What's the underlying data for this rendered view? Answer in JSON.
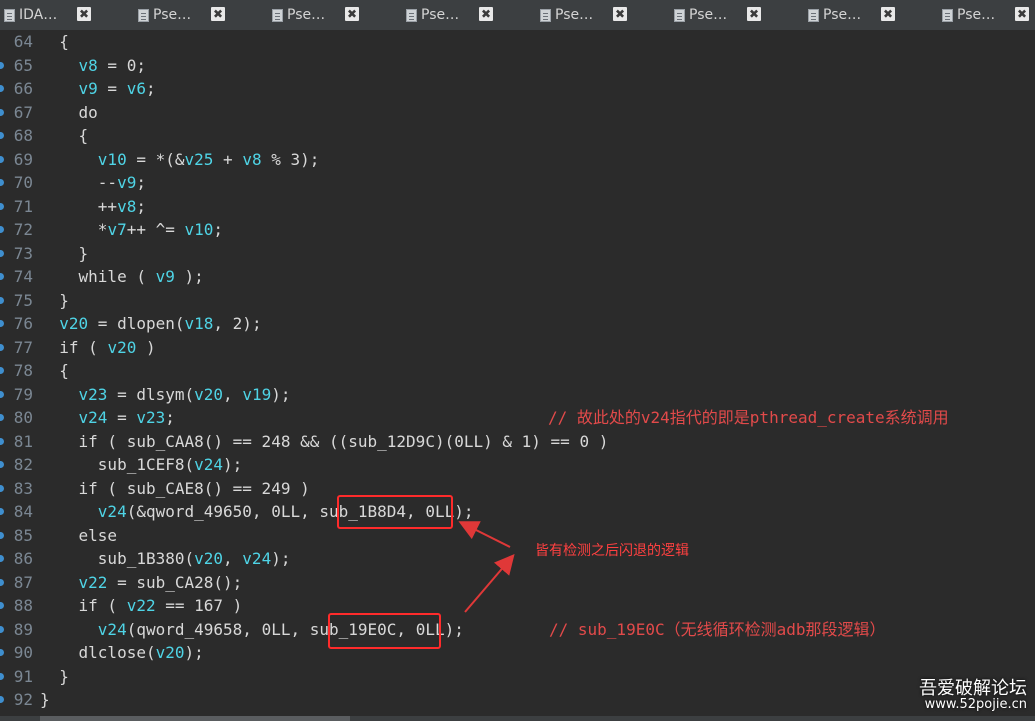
{
  "tabs": [
    {
      "label": "IDA…",
      "icon": "document-icon"
    },
    {
      "label": "Pse…",
      "icon": "document-icon"
    },
    {
      "label": "Pse…",
      "icon": "document-icon"
    },
    {
      "label": "Pse…",
      "icon": "document-icon"
    },
    {
      "label": "Pse…",
      "icon": "document-icon"
    },
    {
      "label": "Pse…",
      "icon": "document-icon"
    },
    {
      "label": "Pse…",
      "icon": "document-icon"
    },
    {
      "label": "Pse…",
      "icon": "document-icon"
    }
  ],
  "close_glyph": "✖",
  "lines": [
    {
      "n": "64",
      "dot": false,
      "indent": "  ",
      "segs": [
        [
          "{",
          ""
        ]
      ]
    },
    {
      "n": "65",
      "dot": true,
      "indent": "    ",
      "segs": [
        [
          "v8",
          "v"
        ],
        [
          " = 0;",
          ""
        ]
      ]
    },
    {
      "n": "66",
      "dot": true,
      "indent": "    ",
      "segs": [
        [
          "v9",
          "v"
        ],
        [
          " = ",
          ""
        ],
        [
          "v6",
          "v"
        ],
        [
          ";",
          ""
        ]
      ]
    },
    {
      "n": "67",
      "dot": true,
      "indent": "    ",
      "segs": [
        [
          "do",
          ""
        ]
      ]
    },
    {
      "n": "68",
      "dot": true,
      "indent": "    ",
      "segs": [
        [
          "{",
          ""
        ]
      ]
    },
    {
      "n": "69",
      "dot": true,
      "indent": "      ",
      "segs": [
        [
          "v10",
          "v"
        ],
        [
          " = *(&",
          ""
        ],
        [
          "v25",
          "v"
        ],
        [
          " + ",
          ""
        ],
        [
          "v8",
          "v"
        ],
        [
          " % 3);",
          ""
        ]
      ]
    },
    {
      "n": "70",
      "dot": true,
      "indent": "      ",
      "segs": [
        [
          "--",
          ""
        ],
        [
          "v9",
          "v"
        ],
        [
          ";",
          ""
        ]
      ]
    },
    {
      "n": "71",
      "dot": true,
      "indent": "      ",
      "segs": [
        [
          "++",
          ""
        ],
        [
          "v8",
          "v"
        ],
        [
          ";",
          ""
        ]
      ]
    },
    {
      "n": "72",
      "dot": true,
      "indent": "      ",
      "segs": [
        [
          "*",
          ""
        ],
        [
          "v7",
          "v"
        ],
        [
          "++ ^= ",
          ""
        ],
        [
          "v10",
          "v"
        ],
        [
          ";",
          ""
        ]
      ]
    },
    {
      "n": "73",
      "dot": true,
      "indent": "    ",
      "segs": [
        [
          "}",
          ""
        ]
      ]
    },
    {
      "n": "74",
      "dot": true,
      "indent": "    ",
      "segs": [
        [
          "while ( ",
          ""
        ],
        [
          "v9",
          "v"
        ],
        [
          " );",
          ""
        ]
      ]
    },
    {
      "n": "75",
      "dot": true,
      "indent": "  ",
      "segs": [
        [
          "}",
          ""
        ]
      ]
    },
    {
      "n": "76",
      "dot": true,
      "indent": "  ",
      "segs": [
        [
          "v20",
          "v"
        ],
        [
          " = dlopen(",
          ""
        ],
        [
          "v18",
          "v"
        ],
        [
          ", 2);",
          ""
        ]
      ]
    },
    {
      "n": "77",
      "dot": true,
      "indent": "  ",
      "segs": [
        [
          "if ( ",
          ""
        ],
        [
          "v20",
          "v"
        ],
        [
          " )",
          ""
        ]
      ]
    },
    {
      "n": "78",
      "dot": true,
      "indent": "  ",
      "segs": [
        [
          "{",
          ""
        ]
      ]
    },
    {
      "n": "79",
      "dot": true,
      "indent": "    ",
      "segs": [
        [
          "v23",
          "v"
        ],
        [
          " = dlsym(",
          ""
        ],
        [
          "v20",
          "v"
        ],
        [
          ", ",
          ""
        ],
        [
          "v19",
          "v"
        ],
        [
          ");",
          ""
        ]
      ]
    },
    {
      "n": "80",
      "dot": true,
      "indent": "    ",
      "segs": [
        [
          "v24",
          "v"
        ],
        [
          " = ",
          ""
        ],
        [
          "v23",
          "v"
        ],
        [
          ";",
          ""
        ]
      ]
    },
    {
      "n": "81",
      "dot": true,
      "indent": "    ",
      "segs": [
        [
          "if ( sub_CAA8() == 248 && ((sub_12D9C)(0LL) & 1) == 0 )",
          ""
        ]
      ]
    },
    {
      "n": "82",
      "dot": true,
      "indent": "      ",
      "segs": [
        [
          "sub_1CEF8(",
          ""
        ],
        [
          "v24",
          "v"
        ],
        [
          ");",
          ""
        ]
      ]
    },
    {
      "n": "83",
      "dot": true,
      "indent": "    ",
      "segs": [
        [
          "if ( sub_CAE8() == 249 )",
          ""
        ]
      ]
    },
    {
      "n": "84",
      "dot": true,
      "indent": "      ",
      "segs": [
        [
          "v24",
          "v"
        ],
        [
          "(&qword_49650, 0LL, sub_1B8D4, 0LL);",
          ""
        ]
      ]
    },
    {
      "n": "85",
      "dot": true,
      "indent": "    ",
      "segs": [
        [
          "else",
          ""
        ]
      ]
    },
    {
      "n": "86",
      "dot": true,
      "indent": "      ",
      "segs": [
        [
          "sub_1B380(",
          ""
        ],
        [
          "v20",
          "v"
        ],
        [
          ", ",
          ""
        ],
        [
          "v24",
          "v"
        ],
        [
          ");",
          ""
        ]
      ]
    },
    {
      "n": "87",
      "dot": true,
      "indent": "    ",
      "segs": [
        [
          "v22",
          "v"
        ],
        [
          " = sub_CA28();",
          ""
        ]
      ]
    },
    {
      "n": "88",
      "dot": true,
      "indent": "    ",
      "segs": [
        [
          "if ( ",
          ""
        ],
        [
          "v22",
          "v"
        ],
        [
          " == 167 )",
          ""
        ]
      ]
    },
    {
      "n": "89",
      "dot": true,
      "indent": "      ",
      "segs": [
        [
          "v24",
          "v"
        ],
        [
          "(qword_49658, 0LL, sub_19E0C, 0LL);",
          ""
        ]
      ]
    },
    {
      "n": "90",
      "dot": true,
      "indent": "    ",
      "segs": [
        [
          "dlclose(",
          ""
        ],
        [
          "v20",
          "v"
        ],
        [
          ");",
          ""
        ]
      ]
    },
    {
      "n": "91",
      "dot": true,
      "indent": "  ",
      "segs": [
        [
          "}",
          ""
        ]
      ]
    },
    {
      "n": "92",
      "dot": true,
      "indent": "",
      "segs": [
        [
          "}",
          ""
        ]
      ]
    }
  ],
  "comments": {
    "line80": "// 故此处的v24指代的即是pthread_create系统调用",
    "line89": "// sub_19E0C（无线循环检测adb那段逻辑）"
  },
  "annotation": "皆有检测之后闪退的逻辑",
  "watermark": {
    "title": "吾爱破解论坛",
    "url": "www.52pojie.cn"
  },
  "colors": {
    "variable": "#4fd4e6",
    "annotation": "#e24a4a",
    "highlight_box": "#ff2b2b"
  }
}
